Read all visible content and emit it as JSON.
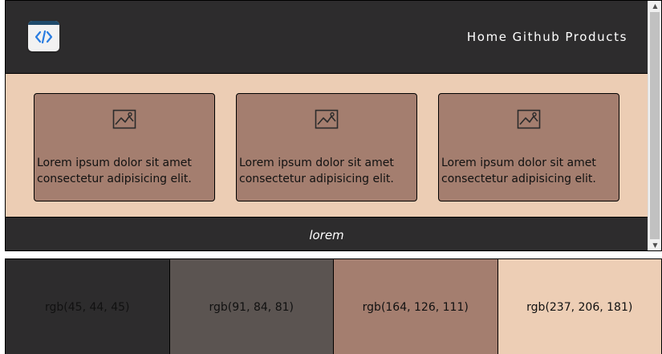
{
  "header": {
    "logo_icon": "code-brackets-icon",
    "nav": [
      "Home",
      "Github",
      "Products"
    ]
  },
  "cards": [
    {
      "icon": "image-icon",
      "text": "Lorem ipsum dolor sit amet consectetur adipisicing elit."
    },
    {
      "icon": "image-icon",
      "text": "Lorem ipsum dolor sit amet consectetur adipisicing elit."
    },
    {
      "icon": "image-icon",
      "text": "Lorem ipsum dolor sit amet consectetur adipisicing elit."
    }
  ],
  "footer": {
    "text": "lorem"
  },
  "palette": [
    {
      "label": "rgb(45, 44, 45)",
      "color": "#2d2c2d"
    },
    {
      "label": "rgb(91, 84, 81)",
      "color": "#5b5451"
    },
    {
      "label": "rgb(164, 126, 111)",
      "color": "#a47e6f"
    },
    {
      "label": "rgb(237, 206, 181)",
      "color": "#edceb5"
    }
  ],
  "colors": {
    "header_bg": "#2d2c2d",
    "page_bg": "#eccdb4",
    "card_bg": "#a47e6f"
  }
}
